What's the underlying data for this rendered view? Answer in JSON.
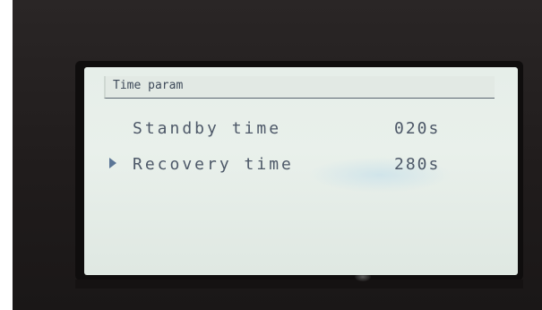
{
  "screen": {
    "header": {
      "title": "Time param"
    },
    "rows": [
      {
        "label": "Standby time",
        "value": "020s",
        "selected": false
      },
      {
        "label": "Recovery time",
        "value": "280s",
        "selected": true
      }
    ]
  },
  "colors": {
    "lcd_background": "#e6eee9",
    "lcd_text": "#4d5868",
    "cursor": "#5b7596",
    "frame": "#221e1e"
  },
  "icons": {
    "selection_cursor": "triangle-right-icon"
  }
}
